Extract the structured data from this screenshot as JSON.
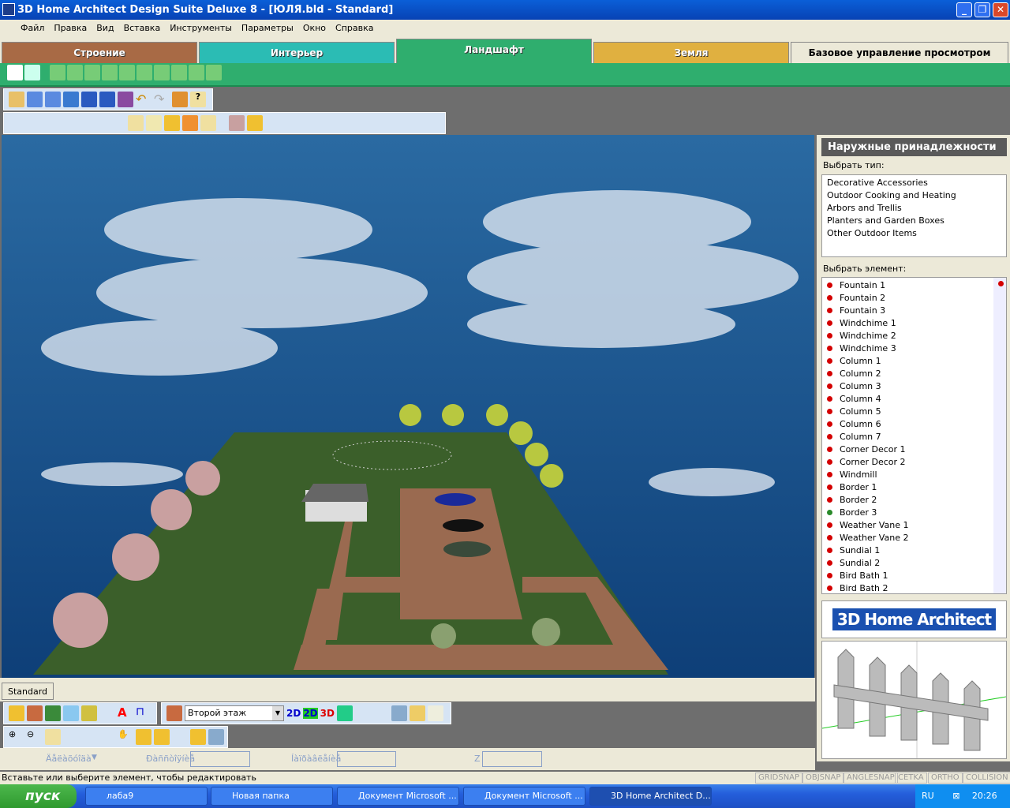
{
  "window": {
    "title": "3D Home Architect Design Suite Deluxe 8 - [ЮЛЯ.bld - Standard]"
  },
  "menu": [
    "Файл",
    "Правка",
    "Вид",
    "Вставка",
    "Инструменты",
    "Параметры",
    "Окно",
    "Справка"
  ],
  "tabs": [
    {
      "label": "Строение",
      "color": "#a86a45"
    },
    {
      "label": "Интерьер",
      "color": "#2bbcb4"
    },
    {
      "label": "Ландшафт",
      "color": "#2fae6e"
    },
    {
      "label": "Земля",
      "color": "#e0b040"
    },
    {
      "label": "Базовое управление просмотром",
      "color": "#ece9d8"
    }
  ],
  "right_panel": {
    "title": "Наружные принадлежности",
    "type_label": "Выбрать тип:",
    "types": [
      "Decorative Accessories",
      "Outdoor Cooking and Heating",
      "Arbors and Trellis",
      "Planters and Garden Boxes",
      "Other Outdoor Items"
    ],
    "element_label": "Выбрать элемент:",
    "elements": [
      "Fountain 1",
      "Fountain 2",
      "Fountain 3",
      "Windchime 1",
      "Windchime 2",
      "Windchime 3",
      "Column 1",
      "Column 2",
      "Column 3",
      "Column 4",
      "Column 5",
      "Column 6",
      "Column 7",
      "Corner Decor 1",
      "Corner Decor 2",
      "Windmill",
      "Border 1",
      "Border 2",
      "Border 3",
      "Weather Vane 1",
      "Weather Vane 2",
      "Sundial 1",
      "Sundial 2",
      "Bird Bath 1",
      "Bird Bath 2"
    ],
    "logo": "3D Home Architect"
  },
  "view_tab": "Standard",
  "floor_select": "Второй этаж",
  "view_buttons": [
    "2D",
    "2D",
    "3D"
  ],
  "coords": {
    "label1": "Äåëàõóîäà",
    "label2": "Ðàññòîÿíèå",
    "label3": "Íàïðàâëåíèå",
    "label4": "Z"
  },
  "status": "Вставьте или выберите элемент, чтобы редактировать",
  "snaps": [
    "GRIDSNAP",
    "OBJSNAP",
    "ANGLESNAP",
    "CETKA",
    "ORTHO",
    "COLLISION"
  ],
  "taskbar": {
    "start": "пуск",
    "items": [
      "лаба9",
      "Новая папка",
      "Документ Microsoft ...",
      "Документ Microsoft ...",
      "3D Home Architect D..."
    ],
    "lang": "RU",
    "time": "20:26"
  }
}
